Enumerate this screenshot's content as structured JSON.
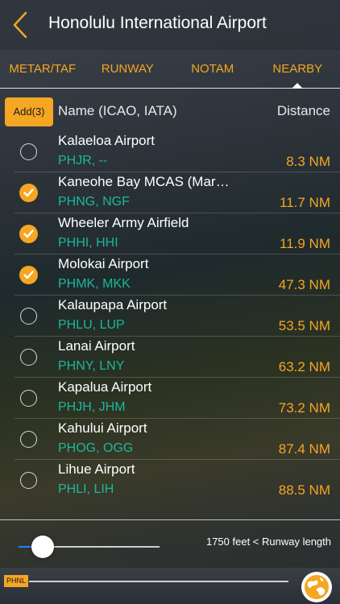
{
  "header": {
    "title": "Honolulu International Airport",
    "back_icon": "chevron-left-icon",
    "accent": "#f5a623"
  },
  "tabs": [
    {
      "label": "METAR/TAF",
      "active": false
    },
    {
      "label": "RUNWAY",
      "active": false
    },
    {
      "label": "NOTAM",
      "active": false
    },
    {
      "label": "NEARBY",
      "active": true
    }
  ],
  "list_header": {
    "add_label": "Add(3)",
    "name_column": "Name (ICAO, IATA)",
    "distance_column": "Distance"
  },
  "airports": [
    {
      "name": "Kalaeloa Airport",
      "codes": "PHJR, --",
      "distance": "8.3 NM",
      "selected": false
    },
    {
      "name": "Kaneohe Bay MCAS (Mar…",
      "codes": "PHNG, NGF",
      "distance": "11.7 NM",
      "selected": true
    },
    {
      "name": "Wheeler Army Airfield",
      "codes": "PHHI, HHI",
      "distance": "11.9 NM",
      "selected": true
    },
    {
      "name": "Molokai Airport",
      "codes": "PHMK, MKK",
      "distance": "47.3 NM",
      "selected": true
    },
    {
      "name": "Kalaupapa Airport",
      "codes": "PHLU, LUP",
      "distance": "53.5 NM",
      "selected": false
    },
    {
      "name": "Lanai Airport",
      "codes": "PHNY, LNY",
      "distance": "63.2 NM",
      "selected": false
    },
    {
      "name": "Kapalua Airport",
      "codes": "PHJH, JHM",
      "distance": "73.2 NM",
      "selected": false
    },
    {
      "name": "Kahului Airport",
      "codes": "PHOG, OGG",
      "distance": "87.4 NM",
      "selected": false
    },
    {
      "name": "Lihue Airport",
      "codes": "PHLI, LIH",
      "distance": "88.5 NM",
      "selected": false
    }
  ],
  "filter": {
    "runway_text": "1750 feet < Runway length",
    "slider_fraction": 0.17
  },
  "map_strip": {
    "airport_tag": "PHNL",
    "globe_icon": "globe-icon"
  },
  "colors": {
    "accent": "#f5a623",
    "code_text": "#1bb89b"
  }
}
